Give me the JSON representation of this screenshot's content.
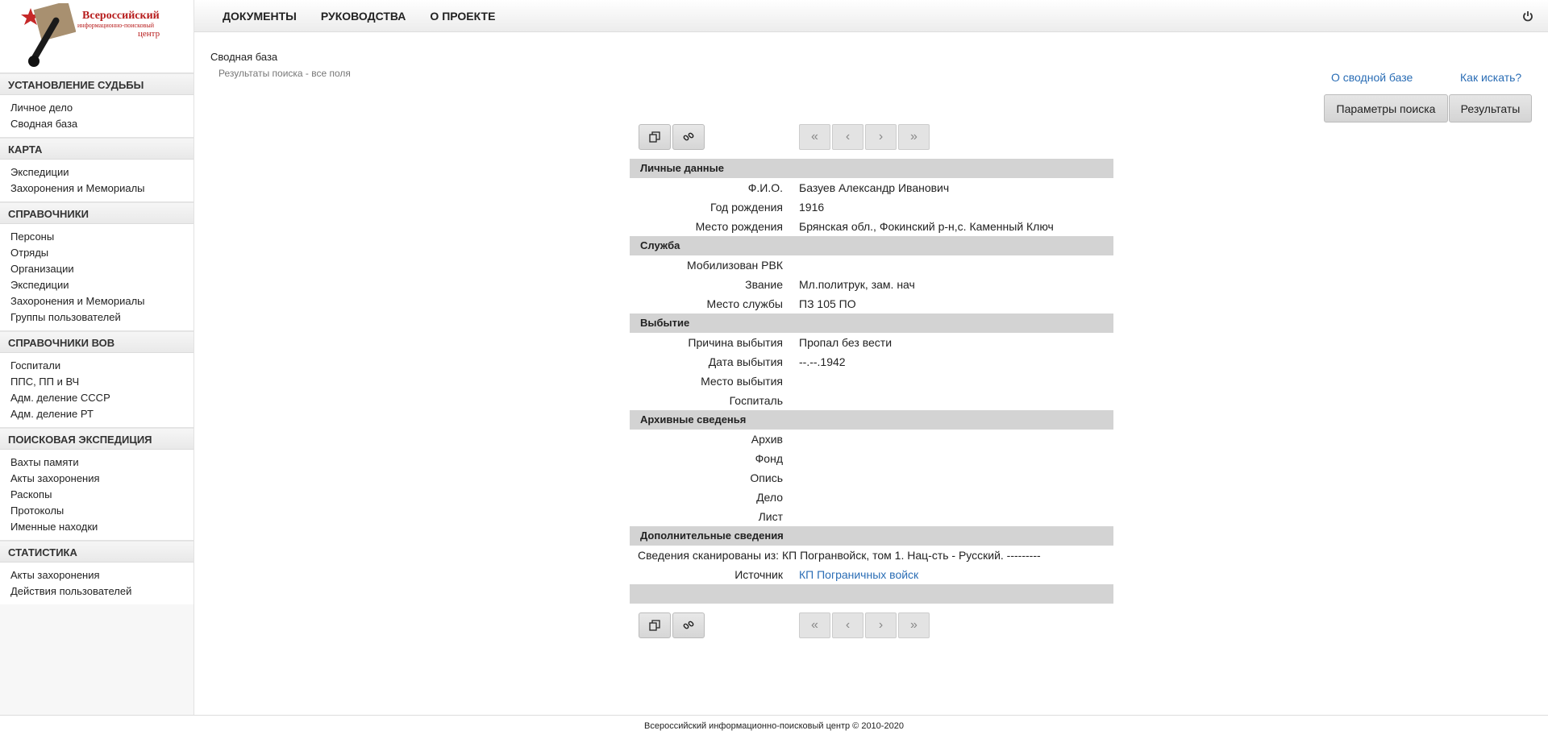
{
  "logo": {
    "line1": "Всероссийский",
    "line2": "информационно-поисковый",
    "line3": "центр"
  },
  "nav": {
    "items": [
      "ДОКУМЕНТЫ",
      "РУКОВОДСТВА",
      "О ПРОЕКТЕ"
    ]
  },
  "sidebar": {
    "sections": [
      {
        "title": "УСТАНОВЛЕНИЕ СУДЬБЫ",
        "items": [
          "Личное дело",
          "Сводная база"
        ]
      },
      {
        "title": "КАРТА",
        "items": [
          "Экспедиции",
          "Захоронения и Мемориалы"
        ]
      },
      {
        "title": "СПРАВОЧНИКИ",
        "items": [
          "Персоны",
          "Отряды",
          "Организации",
          "Экспедиции",
          "Захоронения и Мемориалы",
          "Группы пользователей"
        ]
      },
      {
        "title": "СПРАВОЧНИКИ ВОВ",
        "items": [
          "Госпитали",
          "ППС, ПП и ВЧ",
          "Адм. деление СССР",
          "Адм. деление РТ"
        ]
      },
      {
        "title": "ПОИСКОВАЯ ЭКСПЕДИЦИЯ",
        "items": [
          "Вахты памяти",
          "Акты захоронения",
          "Раскопы",
          "Протоколы",
          "Именные находки"
        ]
      },
      {
        "title": "СТАТИСТИКА",
        "items": [
          "Акты захоронения",
          "Действия пользователей"
        ]
      }
    ]
  },
  "breadcrumb": {
    "title": "Сводная база",
    "subtitle": "Результаты поиска - все поля"
  },
  "links": {
    "about": "О сводной базе",
    "how": "Как искать?"
  },
  "buttons": {
    "params": "Параметры поиска",
    "results": "Результаты"
  },
  "pager": {
    "first": "«",
    "prev": "‹",
    "next": "›",
    "last": "»"
  },
  "record": {
    "personal": {
      "title": "Личные данные",
      "fio_label": "Ф.И.О.",
      "fio": "Базуев Александр Иванович",
      "year_label": "Год рождения",
      "year": "1916",
      "place_label": "Место рождения",
      "place": "Брянская обл., Фокинский р-н,с. Каменный Ключ"
    },
    "service": {
      "title": "Служба",
      "rvk_label": "Мобилизован РВК",
      "rvk": "",
      "rank_label": "Звание",
      "rank": "Мл.политрук, зам. нач",
      "unit_label": "Место службы",
      "unit": "ПЗ 105 ПО"
    },
    "leave": {
      "title": "Выбытие",
      "reason_label": "Причина выбытия",
      "reason": "Пропал без вести",
      "date_label": "Дата выбытия",
      "date": "--.--.1942",
      "place_label": "Место выбытия",
      "place": "",
      "hospital_label": "Госпиталь",
      "hospital": ""
    },
    "archive": {
      "title": "Архивные сведенья",
      "archive_label": "Архив",
      "fond_label": "Фонд",
      "opis_label": "Опись",
      "delo_label": "Дело",
      "list_label": "Лист"
    },
    "extra": {
      "title": "Дополнительные сведения",
      "scan_text": "Сведения сканированы из: КП Погранвойск, том 1. Нац-сть - Русский. ---------",
      "source_label": "Источник",
      "source": "КП Пограничных войск"
    }
  },
  "footer": {
    "text": "Всероссийский информационно-поисковый центр © 2010-2020"
  }
}
